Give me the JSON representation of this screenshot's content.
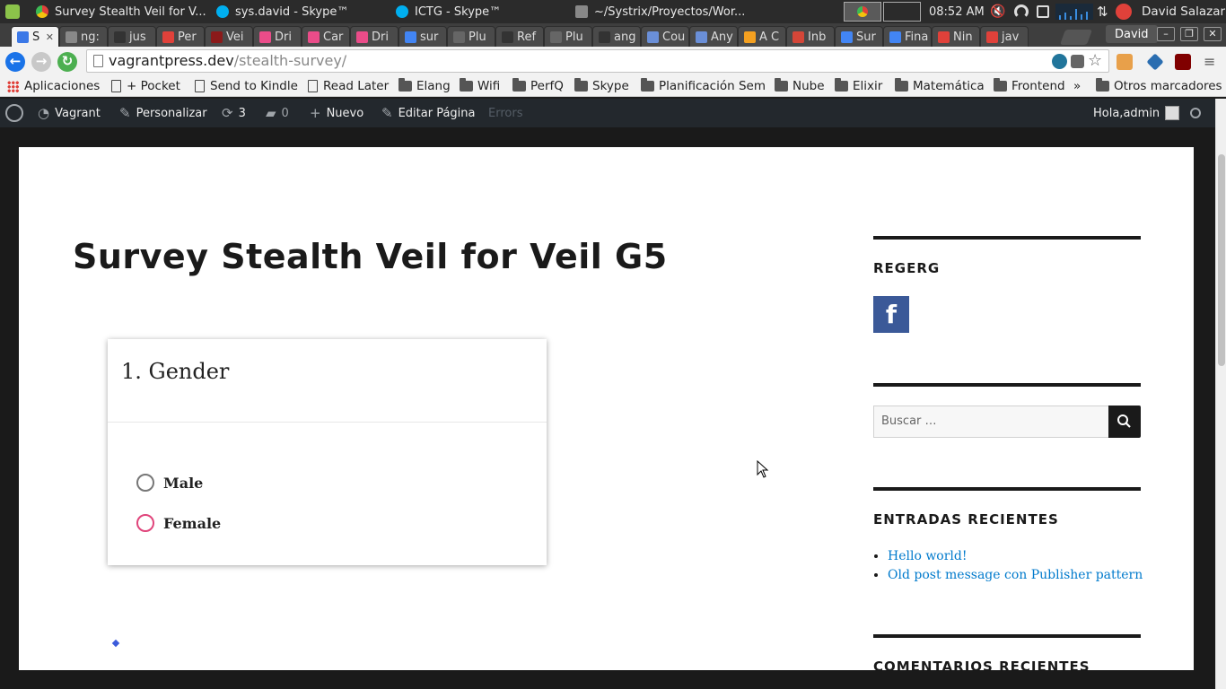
{
  "os_panel": {
    "windows": [
      {
        "title": "Survey Stealth Veil for V...",
        "color": "#e0413a"
      },
      {
        "title": "sys.david - Skype™",
        "color": "#00aff0"
      },
      {
        "title": "ICTG - Skype™",
        "color": "#00aff0"
      },
      {
        "title": "~/Systrix/Proyectos/Wor...",
        "color": "#888888"
      }
    ],
    "clock": "08:52 AM",
    "user": "David Salazar"
  },
  "tabs": [
    {
      "label": "S"
    },
    {
      "label": "ng:"
    },
    {
      "label": "jus"
    },
    {
      "label": "Per"
    },
    {
      "label": "Vei"
    },
    {
      "label": "Dri"
    },
    {
      "label": "Car"
    },
    {
      "label": "Dri"
    },
    {
      "label": "sur"
    },
    {
      "label": "Plu"
    },
    {
      "label": "Ref"
    },
    {
      "label": "Plu"
    },
    {
      "label": "ang"
    },
    {
      "label": "Cou"
    },
    {
      "label": "Any"
    },
    {
      "label": "A C"
    },
    {
      "label": "Inb"
    },
    {
      "label": "Sur"
    },
    {
      "label": "Fina"
    },
    {
      "label": "Nin"
    },
    {
      "label": "jav"
    }
  ],
  "profile_button": "David",
  "address": {
    "host": "vagrantpress.dev",
    "path": "/stealth-survey/"
  },
  "bookmarks": [
    {
      "label": "Aplicaciones",
      "type": "apps"
    },
    {
      "label": "+ Pocket",
      "type": "doc"
    },
    {
      "label": "Send to Kindle",
      "type": "doc"
    },
    {
      "label": "Read Later",
      "type": "doc"
    },
    {
      "label": "Elang",
      "type": "folder"
    },
    {
      "label": "Wifi",
      "type": "folder"
    },
    {
      "label": "PerfQ",
      "type": "folder"
    },
    {
      "label": "Skype",
      "type": "folder"
    },
    {
      "label": "Planificación Sem",
      "type": "folder"
    },
    {
      "label": "Nube",
      "type": "folder"
    },
    {
      "label": "Elixir",
      "type": "folder"
    },
    {
      "label": "Matemática",
      "type": "folder"
    },
    {
      "label": "Frontend",
      "type": "folder"
    }
  ],
  "bookmarks_overflow": "»",
  "bookmarks_other": "Otros marcadores",
  "wp_admin_bar": {
    "site": "Vagrant",
    "customize": "Personalizar",
    "updates": "3",
    "comments": "0",
    "new": "Nuevo",
    "edit": "Editar Página",
    "errors": "Errors",
    "greeting": "Hola,admin"
  },
  "page": {
    "title": "Survey Stealth Veil for Veil G5",
    "survey": {
      "question": "1. Gender",
      "options": [
        "Male",
        "Female"
      ]
    }
  },
  "sidebar": {
    "widget1_title": "REGERG",
    "facebook_letter": "f",
    "search_placeholder": "Buscar …",
    "recent_posts_title": "ENTRADAS RECIENTES",
    "recent_posts": [
      "Hello world!",
      "Old post message con Publisher pattern"
    ],
    "recent_comments_title": "COMENTARIOS RECIENTES"
  }
}
